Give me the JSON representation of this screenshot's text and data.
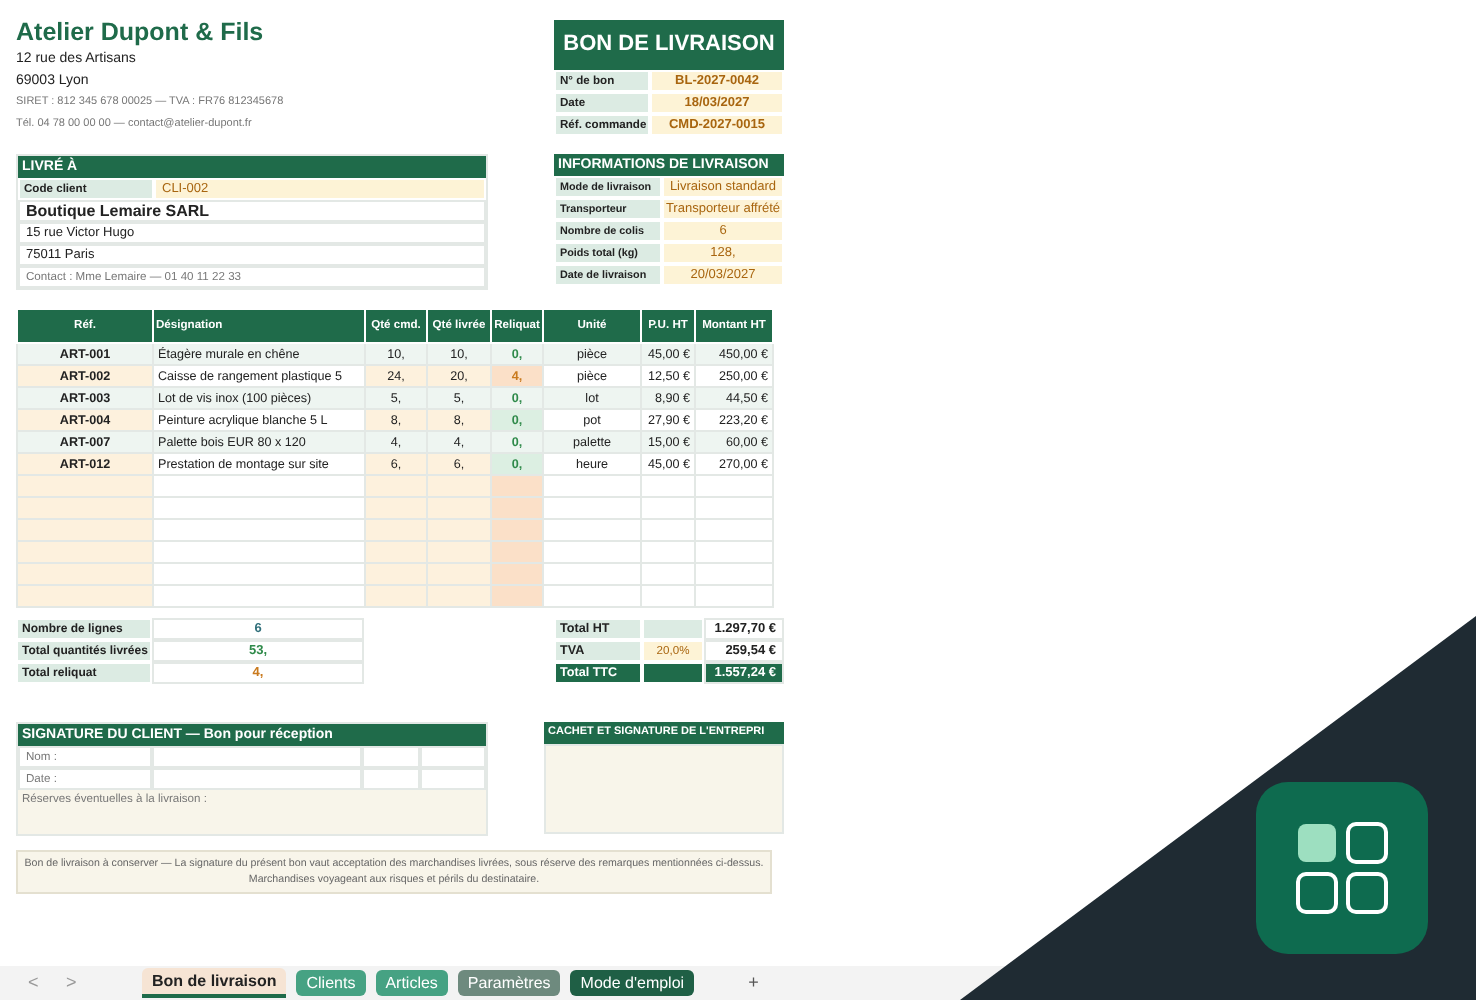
{
  "company": {
    "name": "Atelier Dupont & Fils",
    "lines": [
      "12 rue des Artisans",
      "69003 Lyon"
    ],
    "small_lines": [
      "SIRET : 812 345 678 00025 — TVA : FR76 812345678",
      "Tél. 04 78 00 00 00 — contact@atelier-dupont.fr"
    ]
  },
  "document": {
    "title": "BON DE LIVRAISON",
    "fields": [
      {
        "label": "N° de bon",
        "value": "BL-2027-0042"
      },
      {
        "label": "Date",
        "value": "18/03/2027"
      },
      {
        "label": "Réf. commande",
        "value": "CMD-2027-0015"
      }
    ]
  },
  "ship_to": {
    "title": "LIVRÉ À",
    "code_label": "Code client",
    "code_value": "CLI-002",
    "name": "Boutique Lemaire SARL",
    "lines": [
      "15 rue Victor Hugo",
      "75011 Paris"
    ],
    "contact": "Contact : Mme Lemaire — 01 40 11 22 33"
  },
  "delivery_info": {
    "title": "INFORMATIONS DE LIVRAISON",
    "fields": [
      {
        "label": "Mode de livraison",
        "value": "Livraison standard"
      },
      {
        "label": "Transporteur",
        "value": "Transporteur affrété"
      },
      {
        "label": "Nombre de colis",
        "value": "6"
      },
      {
        "label": "Poids total (kg)",
        "value": "128,"
      },
      {
        "label": "Date de livraison",
        "value": "20/03/2027"
      }
    ]
  },
  "items": {
    "columns": [
      "Réf.",
      "Désignation",
      "Qté cmd.",
      "Qté livrée",
      "Reliquat",
      "Unité",
      "P.U. HT",
      "Montant HT"
    ],
    "rows": [
      {
        "ref": "ART-001",
        "designation": "Étagère murale en chêne",
        "qty_ordered": "10,",
        "qty_delivered": "10,",
        "backorder": "0,",
        "pending": false,
        "unit": "pièce",
        "unit_price": "45,00 €",
        "amount": "450,00 €"
      },
      {
        "ref": "ART-002",
        "designation": "Caisse de rangement plastique 5",
        "qty_ordered": "24,",
        "qty_delivered": "20,",
        "backorder": "4,",
        "pending": true,
        "unit": "pièce",
        "unit_price": "12,50 €",
        "amount": "250,00 €"
      },
      {
        "ref": "ART-003",
        "designation": "Lot de vis inox (100 pièces)",
        "qty_ordered": "5,",
        "qty_delivered": "5,",
        "backorder": "0,",
        "pending": false,
        "unit": "lot",
        "unit_price": "8,90 €",
        "amount": "44,50 €"
      },
      {
        "ref": "ART-004",
        "designation": "Peinture acrylique blanche 5 L",
        "qty_ordered": "8,",
        "qty_delivered": "8,",
        "backorder": "0,",
        "pending": false,
        "unit": "pot",
        "unit_price": "27,90 €",
        "amount": "223,20 €"
      },
      {
        "ref": "ART-007",
        "designation": "Palette bois EUR 80 x 120",
        "qty_ordered": "4,",
        "qty_delivered": "4,",
        "backorder": "0,",
        "pending": false,
        "unit": "palette",
        "unit_price": "15,00 €",
        "amount": "60,00 €"
      },
      {
        "ref": "ART-012",
        "designation": "Prestation de montage sur site",
        "qty_ordered": "6,",
        "qty_delivered": "6,",
        "backorder": "0,",
        "pending": false,
        "unit": "heure",
        "unit_price": "45,00 €",
        "amount": "270,00 €"
      }
    ]
  },
  "summary": [
    {
      "label": "Nombre de lignes",
      "value": "6",
      "kind": "count"
    },
    {
      "label": "Total quantités livrées",
      "value": "53,",
      "kind": "delivered"
    },
    {
      "label": "Total reliquat",
      "value": "4,",
      "kind": "pending"
    }
  ],
  "totals": [
    {
      "label": "Total HT",
      "value": "1.297,70 €",
      "kind": "subtotal"
    },
    {
      "label": "TVA",
      "rate": "20,0%",
      "value": "259,54 €",
      "kind": "tax"
    },
    {
      "label": "Total TTC",
      "value": "1.557,24 €",
      "kind": "grand"
    }
  ],
  "signature": {
    "title": "SIGNATURE DU CLIENT — Bon pour réception",
    "fields": [
      "Nom :",
      "Date :"
    ],
    "remarks": "Réserves éventuelles à la livraison :"
  },
  "stamp": {
    "title": "CACHET ET SIGNATURE DE L'ENTREPRI"
  },
  "note": [
    "Bon de livraison à conserver — La signature du présent bon vaut acceptation des marchandises livrées, sous réserve des remarques mentionnées ci-dessus.",
    "Marchandises voyageant aux risques et périls du destinataire."
  ],
  "sheet_tabs": {
    "prev": "<",
    "next": ">",
    "add": "+",
    "tabs": [
      {
        "label": "Bon de livraison",
        "selected": true,
        "color": "#f6e4d4"
      },
      {
        "label": "Clients",
        "selected": false,
        "color": "#46a283"
      },
      {
        "label": "Articles",
        "selected": false,
        "color": "#46a283"
      },
      {
        "label": "Paramètres",
        "selected": false,
        "color": "#6e8a7e"
      },
      {
        "label": "Mode d'emploi",
        "selected": false,
        "color": "#1f5f45"
      }
    ]
  }
}
